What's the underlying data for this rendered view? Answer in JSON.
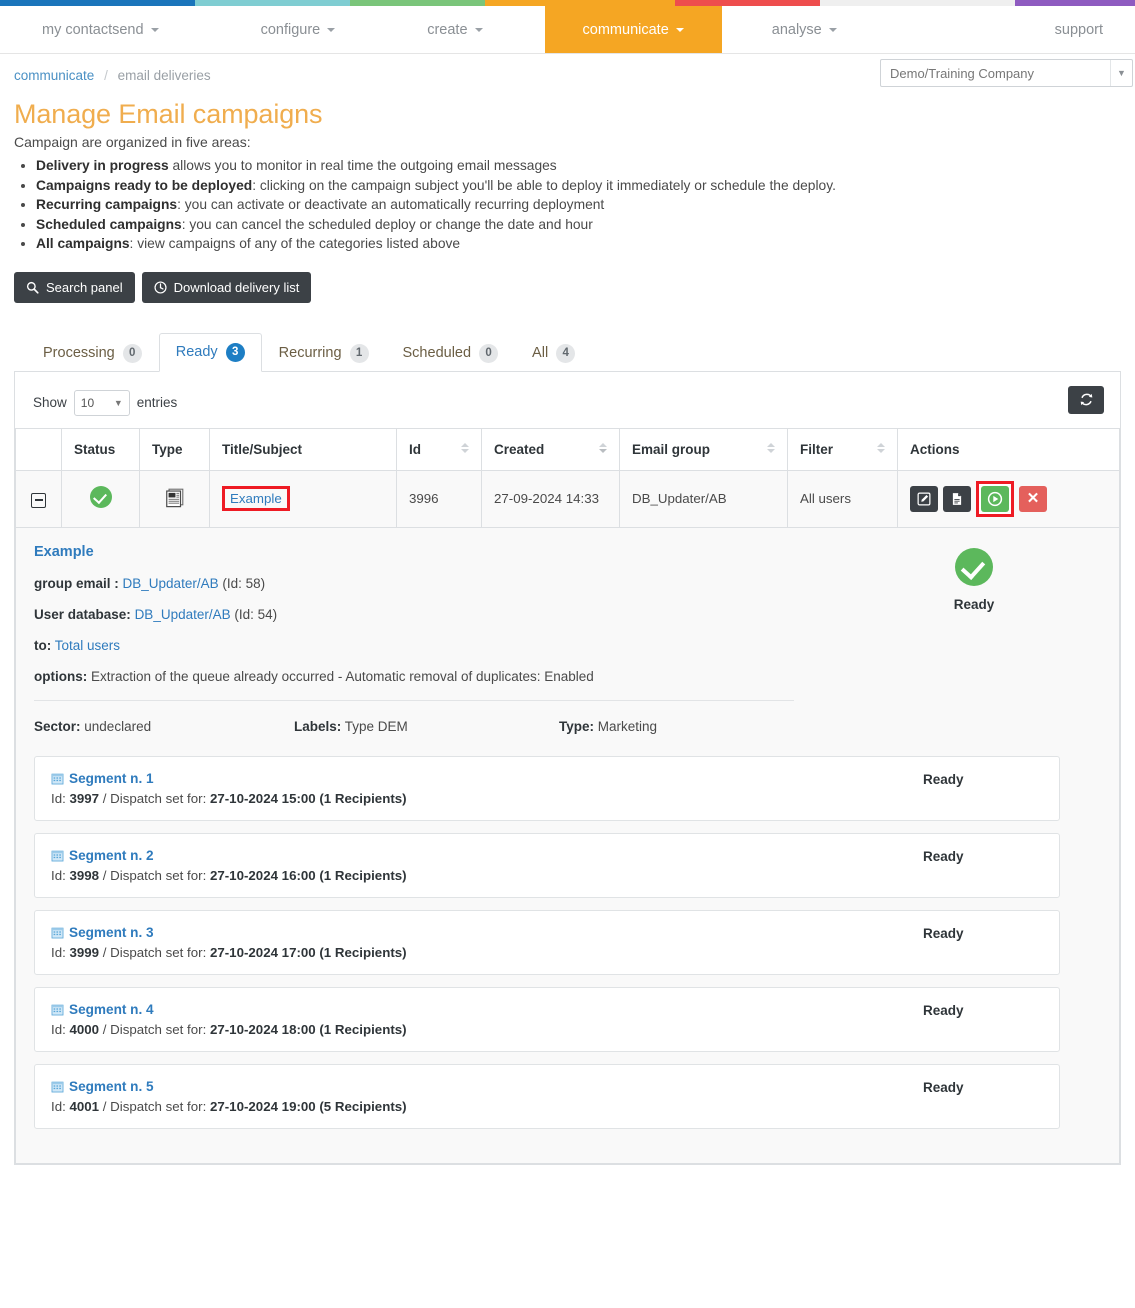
{
  "topbar_colors": [
    "#1a75bb",
    "#7fcdd2",
    "#7ac57a",
    "#f5a623",
    "#ee4d4d",
    "#efefef",
    "#8e5bc0"
  ],
  "nav": {
    "items": [
      {
        "label": "my contactsend",
        "has_caret": true,
        "active": false
      },
      {
        "label": "configure",
        "has_caret": true,
        "active": false
      },
      {
        "label": "create",
        "has_caret": true,
        "active": false
      },
      {
        "label": "communicate",
        "has_caret": true,
        "active": true
      },
      {
        "label": "analyse",
        "has_caret": true,
        "active": false
      }
    ],
    "support_label": "support"
  },
  "breadcrumb": {
    "root": "communicate",
    "separator": "/",
    "current": "email deliveries"
  },
  "company_select": {
    "value": "Demo/Training Company",
    "caret": "▼"
  },
  "page": {
    "title": "Manage Email campaigns",
    "lead": "Campaign are organized in five areas:",
    "areas": [
      {
        "term": "Delivery in progress",
        "desc": " allows you to monitor in real time the outgoing email messages"
      },
      {
        "term": "Campaigns ready to be deployed",
        "desc": ": clicking on the campaign subject you'll be able to deploy it immediately or schedule the deploy."
      },
      {
        "term": "Recurring campaigns",
        "desc": ": you can activate or deactivate an automatically recurring deployment"
      },
      {
        "term": "Scheduled campaigns",
        "desc": ": you can cancel the scheduled deploy or change the date and hour"
      },
      {
        "term": "All campaigns",
        "desc": ": view campaigns of any of the categories listed above"
      }
    ]
  },
  "toolbar": {
    "search_panel_label": "Search panel",
    "download_label": "Download delivery list"
  },
  "tabs": [
    {
      "label": "Processing",
      "count": "0",
      "active": false
    },
    {
      "label": "Ready",
      "count": "3",
      "active": true
    },
    {
      "label": "Recurring",
      "count": "1",
      "active": false
    },
    {
      "label": "Scheduled",
      "count": "0",
      "active": false
    },
    {
      "label": "All",
      "count": "4",
      "active": false
    }
  ],
  "table_controls": {
    "show_label": "Show",
    "entries_value": "10",
    "entries_label": "entries",
    "refresh_title": "refresh-icon"
  },
  "table": {
    "headers": [
      "",
      "Status",
      "Type",
      "Title/Subject",
      "Id",
      "Created",
      "Email group",
      "Filter",
      "Actions"
    ],
    "row": {
      "status": "ready-check-icon",
      "type": "newspaper-icon",
      "title": "Example",
      "id": "3996",
      "created": "27-09-2024 14:33",
      "email_group": "DB_Updater/AB",
      "filter": "All users",
      "actions": [
        "edit-icon",
        "report-icon",
        "play-icon",
        "delete-icon"
      ]
    }
  },
  "detail": {
    "title": "Example",
    "group_email_label": "group email :",
    "group_email_value": "DB_Updater/AB",
    "group_email_id": "(Id: 58)",
    "user_db_label": "User database:",
    "user_db_value": "DB_Updater/AB",
    "user_db_id": "(Id: 54)",
    "to_label": "to:",
    "to_value": "Total users",
    "options_label": "options:",
    "options_value": "Extraction of the queue already occurred - Automatic removal of duplicates: Enabled",
    "status_label": "Ready",
    "sector_label": "Sector:",
    "sector_value": "undeclared",
    "labels_label": "Labels:",
    "labels_value": "Type DEM",
    "type_label": "Type:",
    "type_value": "Marketing",
    "segments": [
      {
        "title": "Segment n. 1",
        "id_label": "Id:",
        "id": "3997",
        "sep": "/ Dispatch set for:",
        "datetime": "27-10-2024 15:00 (1 Recipients)",
        "status": "Ready"
      },
      {
        "title": "Segment n. 2",
        "id_label": "Id:",
        "id": "3998",
        "sep": "/ Dispatch set for:",
        "datetime": "27-10-2024 16:00 (1 Recipients)",
        "status": "Ready"
      },
      {
        "title": "Segment n. 3",
        "id_label": "Id:",
        "id": "3999",
        "sep": "/ Dispatch set for:",
        "datetime": "27-10-2024 17:00 (1 Recipients)",
        "status": "Ready"
      },
      {
        "title": "Segment n. 4",
        "id_label": "Id:",
        "id": "4000",
        "sep": "/ Dispatch set for:",
        "datetime": "27-10-2024 18:00 (1 Recipients)",
        "status": "Ready"
      },
      {
        "title": "Segment n. 5",
        "id_label": "Id:",
        "id": "4001",
        "sep": "/ Dispatch set for:",
        "datetime": "27-10-2024 19:00 (5 Recipients)",
        "status": "Ready"
      }
    ]
  },
  "colors": {
    "accent_orange": "#f0ad4e",
    "link_blue": "#2f7bbd",
    "success_green": "#5cb85c",
    "danger_red": "#e4605c",
    "highlight_red": "#ee1b24",
    "dark_button": "#3c4146"
  }
}
